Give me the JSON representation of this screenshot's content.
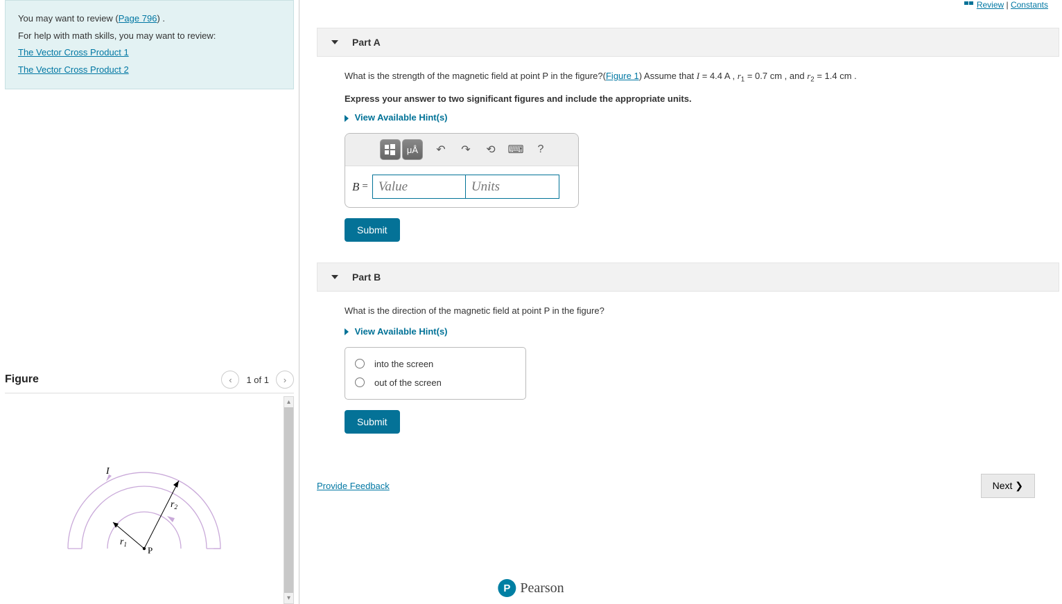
{
  "top_links": {
    "review": "Review",
    "constants": "Constants"
  },
  "tips": {
    "line1_pre": "You may want to review (",
    "page_link": "Page 796",
    "line1_post": ") .",
    "line2": "For help with math skills, you may want to review:",
    "link1": "The Vector Cross Product 1",
    "link2": "The Vector Cross Product 2"
  },
  "figure_panel": {
    "title": "Figure",
    "count": "1 of 1",
    "prev": "‹",
    "next": "›"
  },
  "figure_labels": {
    "I": "I",
    "r1": "r",
    "r1sub": "1",
    "r2": "r",
    "r2sub": "2",
    "P": "P"
  },
  "partA": {
    "title": "Part A",
    "q_pre": "What is the strength of the magnetic field at point P in the figure?(",
    "fig_link": "Figure 1",
    "q_mid": ") Assume that ",
    "I": "I",
    "Ieq": " = 4.4 A ",
    "Iunit": "",
    "sep1": ", ",
    "r1": "r",
    "r1sub": "1",
    "r1eq": " = 0.7 cm ",
    "sep2": ", and ",
    "r2": "r",
    "r2sub": "2",
    "r2eq": " = 1.4 cm ",
    "period": ".",
    "instruct": "Express your answer to two significant figures and include the appropriate units.",
    "hints": "View Available Hint(s)",
    "var": "B",
    "eq": "=",
    "value_ph": "Value",
    "units_ph": "Units",
    "submit": "Submit",
    "tb_units": "μÅ"
  },
  "partB": {
    "title": "Part B",
    "q": "What is the direction of the magnetic field at point P in the figure?",
    "hints": "View Available Hint(s)",
    "opt1": "into the screen",
    "opt2": "out of the screen",
    "submit": "Submit"
  },
  "feedback": "Provide Feedback",
  "next": "Next ❯",
  "brand": "Pearson"
}
